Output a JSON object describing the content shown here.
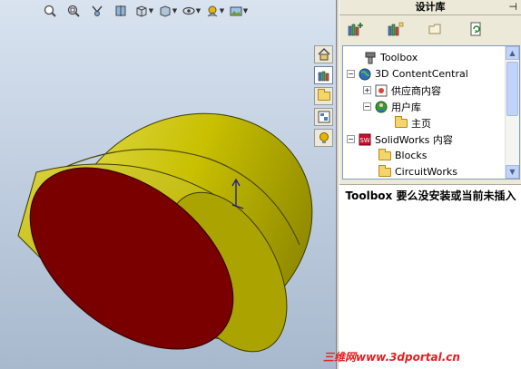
{
  "toolbar": {
    "icons": [
      "zoom-to-fit-icon",
      "zoom-area-icon",
      "view-orientation-icon",
      "section-view-icon",
      "view-orientation-cube-icon",
      "display-style-icon",
      "hide-show-icon",
      "appearance-icon",
      "scene-icon"
    ]
  },
  "task_pane": {
    "title": "设计库",
    "pin_glyph": "⊣",
    "tabs": [
      "home-icon",
      "design-library-icon",
      "file-explorer-icon",
      "view-palette-icon",
      "appearances-icon"
    ],
    "toolbar_icons": [
      "add-to-library-icon",
      "add-file-location-icon",
      "create-new-folder-icon",
      "refresh-icon"
    ],
    "tree": [
      {
        "label": "Toolbox",
        "level": 1,
        "icon": "toolbox-icon",
        "expander": ""
      },
      {
        "label": "3D ContentCentral",
        "level": 0,
        "icon": "globe-icon",
        "expander": "−"
      },
      {
        "label": "供应商内容",
        "level": 1,
        "icon": "supplier-content-icon",
        "expander": "+"
      },
      {
        "label": "用户库",
        "level": 1,
        "icon": "user-library-icon",
        "expander": "−"
      },
      {
        "label": "主页",
        "level": 2,
        "icon": "folder-icon",
        "expander": ""
      },
      {
        "label": "SolidWorks 内容",
        "level": 0,
        "icon": "solidworks-icon",
        "expander": "−"
      },
      {
        "label": "Blocks",
        "level": 1,
        "icon": "folder-icon",
        "expander": ""
      },
      {
        "label": "CircuitWorks",
        "level": 1,
        "icon": "folder-icon",
        "expander": ""
      }
    ],
    "message": "Toolbox 要么没安装或当前未插入"
  },
  "watermark": "三维网www.3dportal.cn",
  "colors": {
    "viewport_top": "#d9e3f0",
    "viewport_bottom": "#a9b9cd",
    "model_yellow": "#c8c000",
    "model_red": "#7a0000",
    "panel_bg": "#ece9d8",
    "watermark_red": "#e02020"
  }
}
